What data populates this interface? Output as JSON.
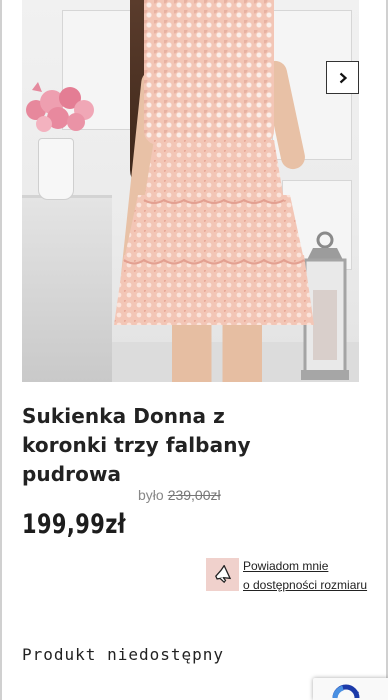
{
  "product": {
    "title": "Sukienka Donna z koronki trzy falbany pudrowa",
    "old_price_label": "było",
    "old_price": "239,00zł",
    "price": "199,99zł"
  },
  "gallery": {
    "next_icon": "chevron-right-icon"
  },
  "notify": {
    "icon": "megaphone-icon",
    "line1": "Powiadom mnie",
    "line2": "o dostępności rozmiaru"
  },
  "status": {
    "unavailable": "Produkt niedostępny"
  },
  "colors": {
    "notify_icon_bg": "#f0d1cc",
    "dress": "#f3c6b6"
  }
}
